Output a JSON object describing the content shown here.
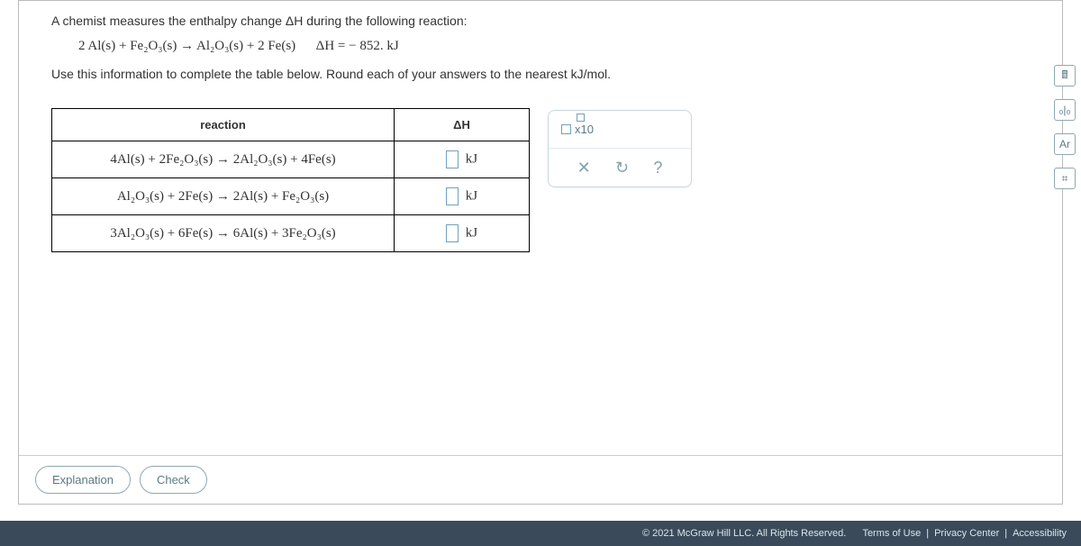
{
  "question": {
    "line1": "A chemist measures the enthalpy change ΔH during the following reaction:",
    "reaction_text": "2 Al(s)  +  Fe₂O₃(s) → Al₂O₃(s)  +  2 Fe(s)",
    "dh_given": "ΔH = − 852.  kJ",
    "line2": "Use this information to complete the table below. Round each of your answers to the nearest kJ/mol."
  },
  "table": {
    "header_reaction": "reaction",
    "header_dh": "ΔH",
    "rows": [
      {
        "reaction": "4Al(s)  +  2Fe₂O₃(s)  →  2Al₂O₃(s)  +  4Fe(s)",
        "unit": "kJ"
      },
      {
        "reaction": "Al₂O₃(s)  +  2Fe(s)  →  2Al(s)  +  Fe₂O₃(s)",
        "unit": "kJ"
      },
      {
        "reaction": "3Al₂O₃(s)  +  6Fe(s)  →  6Al(s)  +  3Fe₂O₃(s)",
        "unit": "kJ"
      }
    ]
  },
  "help_panel": {
    "sci_label": "x10",
    "clear_icon": "✕",
    "reset_icon": "↻",
    "help_icon": "?"
  },
  "side_tools": {
    "calc": "🖩",
    "graph": "₀|₀",
    "ar": "Ar",
    "table": "⌗"
  },
  "buttons": {
    "explanation": "Explanation",
    "check": "Check"
  },
  "footer": {
    "copyright": "© 2021 McGraw Hill LLC. All Rights Reserved.",
    "terms": "Terms of Use",
    "privacy": "Privacy Center",
    "accessibility": "Accessibility",
    "sep": "|"
  }
}
